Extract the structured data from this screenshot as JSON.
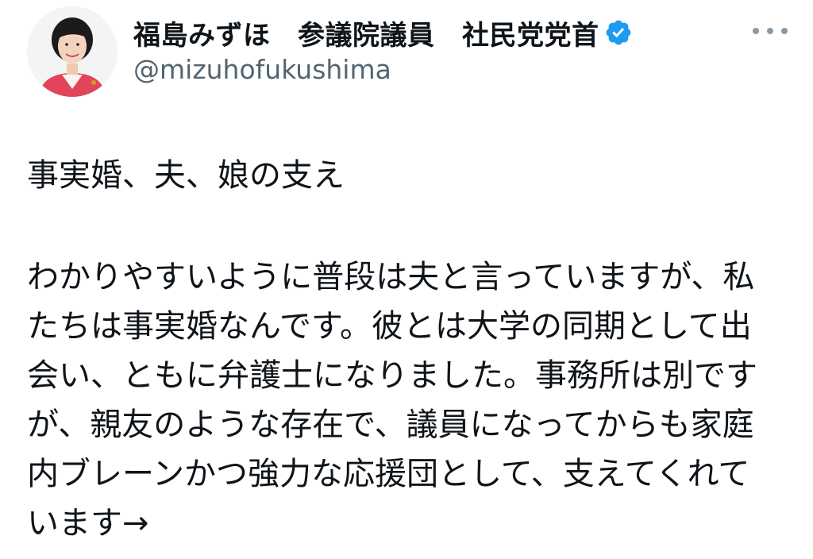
{
  "author": {
    "display_name": "福島みずほ　参議院議員　社民党党首",
    "handle": "@mizuhofukushima",
    "verified_icon": "verified-badge-icon",
    "verified_color": "#1d9bf0",
    "avatar_icon": "profile-avatar"
  },
  "more_icon": "more-horizontal-icon",
  "tweet": {
    "headline": "事実婚、夫、娘の支え",
    "lines": [
      "わかりやすいように普段は夫と言っていますが、私",
      "たちは事実婚なんです。彼とは大学の同期として出",
      "会い、ともに弁護士になりました。事務所は別です",
      "が、親友のような存在で、議員になってからも家庭",
      "内ブレーンかつ強力な応援団として、支えてくれて",
      "います→"
    ]
  },
  "colors": {
    "text": "#0f1419",
    "secondary_text": "#536471",
    "background": "#ffffff"
  }
}
